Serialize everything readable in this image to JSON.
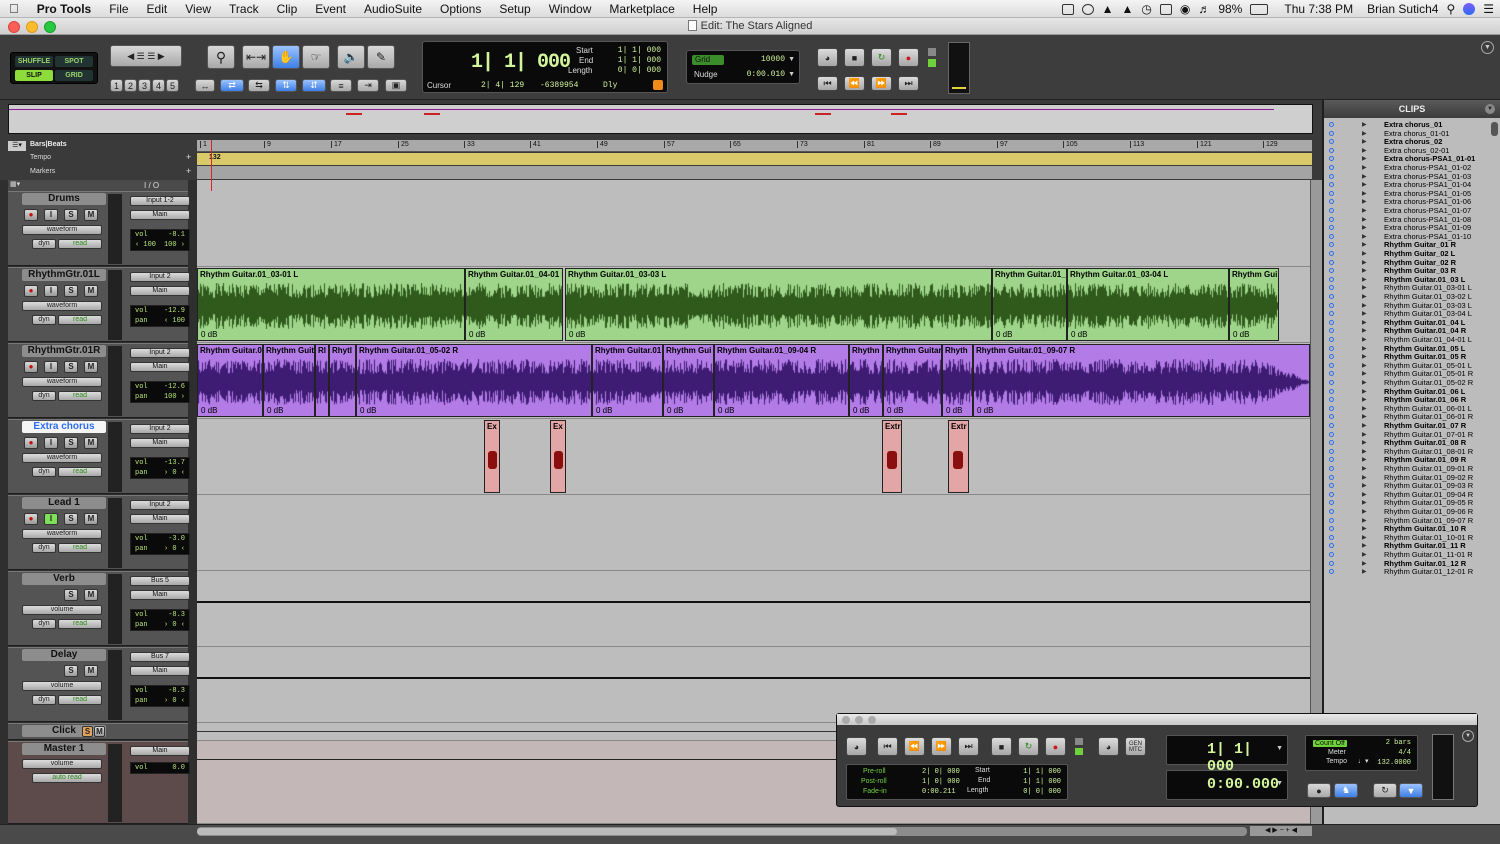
{
  "menubar": {
    "apple": "",
    "items": [
      "Pro Tools",
      "File",
      "Edit",
      "View",
      "Track",
      "Clip",
      "Event",
      "AudioSuite",
      "Options",
      "Setup",
      "Window",
      "Marketplace",
      "Help"
    ],
    "battery": "98%",
    "clock": "Thu 7:38 PM",
    "user": "Brian Sutich4"
  },
  "window": {
    "title": "Edit: The Stars Aligned"
  },
  "modes": {
    "shuffle": "SHUFFLE",
    "spot": "SPOT",
    "slip": "SLIP",
    "grid": "GRID"
  },
  "zoom_presets": [
    "1",
    "2",
    "3",
    "4",
    "5"
  ],
  "counter": {
    "main": "1| 1| 000",
    "start_label": "Start",
    "end_label": "End",
    "length_label": "Length",
    "start": "1| 1| 000",
    "end": "1| 1| 000",
    "length": "0| 0| 000",
    "cursor_label": "Cursor",
    "cursor": "2| 4| 129",
    "cursor_val": "-6389954",
    "dly": "Dly"
  },
  "grid": {
    "grid_label": "Grid",
    "grid_value": "10000",
    "nudge_label": "Nudge",
    "nudge_value": "0:00.010"
  },
  "rulers": {
    "bars_label": "Bars|Beats",
    "tempo_label": "Tempo",
    "markers_label": "Markers",
    "tempo_value": "132",
    "ticks": [
      "1",
      "9",
      "17",
      "25",
      "33",
      "41",
      "49",
      "57",
      "65",
      "73",
      "81",
      "89",
      "97",
      "105",
      "113",
      "121",
      "129"
    ]
  },
  "io_label": "I / O",
  "tracks": [
    {
      "name": "Drums",
      "io_in": "Input 1-2",
      "io_out": "Main",
      "view": "waveform",
      "dyn": "dyn",
      "auto": "read",
      "vol_label": "vol",
      "vol": "-8.1",
      "pan_label": "‹ 100",
      "pan": "100 ›",
      "selected": false
    },
    {
      "name": "RhythmGtr.01L",
      "io_in": "Input 2",
      "io_out": "Main",
      "view": "waveform",
      "dyn": "dyn",
      "auto": "read",
      "vol_label": "vol",
      "vol": "-12.9",
      "pan_label": "pan",
      "pan": "‹ 100",
      "selected": false
    },
    {
      "name": "RhythmGtr.01R",
      "io_in": "Input 2",
      "io_out": "Main",
      "view": "waveform",
      "dyn": "dyn",
      "auto": "read",
      "vol_label": "vol",
      "vol": "-12.6",
      "pan_label": "pan",
      "pan": "100 ›",
      "selected": false
    },
    {
      "name": "Extra chorus",
      "io_in": "Input 2",
      "io_out": "Main",
      "view": "waveform",
      "dyn": "dyn",
      "auto": "read",
      "vol_label": "vol",
      "vol": "-13.7",
      "pan_label": "pan",
      "pan": "› 0 ‹",
      "selected": true
    },
    {
      "name": "Lead 1",
      "io_in": "Input 2",
      "io_out": "Main",
      "view": "waveform",
      "dyn": "dyn",
      "auto": "read",
      "vol_label": "vol",
      "vol": "-3.0",
      "pan_label": "pan",
      "pan": "› 0 ‹",
      "selected": false
    },
    {
      "name": "Verb",
      "io_in": "Bus 5",
      "io_out": "Main",
      "view": "volume",
      "dyn": "dyn",
      "auto": "read",
      "vol_label": "vol",
      "vol": "-8.3",
      "pan_label": "pan",
      "pan": "› 0 ‹",
      "selected": false
    },
    {
      "name": "Delay",
      "io_in": "Bus 7",
      "io_out": "Main",
      "view": "volume",
      "dyn": "dyn",
      "auto": "read",
      "vol_label": "vol",
      "vol": "-8.3",
      "pan_label": "pan",
      "pan": "› 0 ‹",
      "selected": false
    }
  ],
  "click_track": {
    "name": "Click"
  },
  "master_track": {
    "name": "Master 1",
    "io_out": "Main",
    "view": "volume",
    "auto": "auto read",
    "vol_label": "vol",
    "vol": "0.0"
  },
  "clip_gain": "0 dB",
  "lane_clips": {
    "gtr_l": [
      "Rhythm Guitar.01_03-01 L",
      "Rhythm Guitar.01_04-01 L",
      "Rhythm Guitar.01_03-03 L",
      "Rhythm Guitar.01_",
      "Rhythm Guitar.01_03-04 L",
      "Rhythm Gui"
    ],
    "gtr_r": [
      "Rhythm Guitar.0",
      "Rhythm Guit",
      "Rl",
      "Rhytl",
      "Rhythm Guitar.01_05-02 R",
      "Rhythm Guitar.01",
      "Rhythm Gui",
      "Rhythm Guitar.01_09-04 R",
      "Rhythn",
      "Rhythm Guitar",
      "Rhyth",
      "Rhythm Guitar.01_09-07 R"
    ],
    "extra": [
      "Ex",
      "Ex",
      "Extr",
      "Extr"
    ]
  },
  "clips_list": {
    "title": "CLIPS",
    "items": [
      [
        "Extra chorus_01",
        true
      ],
      [
        "Extra chorus_01-01",
        false
      ],
      [
        "Extra chorus_02",
        true
      ],
      [
        "Extra chorus_02-01",
        false
      ],
      [
        "Extra chorus-PSA1_01-01",
        true
      ],
      [
        "Extra chorus-PSA1_01-02",
        false
      ],
      [
        "Extra chorus-PSA1_01-03",
        false
      ],
      [
        "Extra chorus-PSA1_01-04",
        false
      ],
      [
        "Extra chorus-PSA1_01-05",
        false
      ],
      [
        "Extra chorus-PSA1_01-06",
        false
      ],
      [
        "Extra chorus-PSA1_01-07",
        false
      ],
      [
        "Extra chorus-PSA1_01-08",
        false
      ],
      [
        "Extra chorus-PSA1_01-09",
        false
      ],
      [
        "Extra chorus-PSA1_01-10",
        false
      ],
      [
        "Rhythm Guitar_01 R",
        true
      ],
      [
        "Rhythm Guitar_02 L",
        true
      ],
      [
        "Rhythm Guitar_02 R",
        true
      ],
      [
        "Rhythm Guitar_03 R",
        true
      ],
      [
        "Rhythm Guitar.01_03 L",
        true
      ],
      [
        "Rhythm Guitar.01_03-01 L",
        false
      ],
      [
        "Rhythm Guitar.01_03-02 L",
        false
      ],
      [
        "Rhythm Guitar.01_03-03 L",
        false
      ],
      [
        "Rhythm Guitar.01_03-04 L",
        false
      ],
      [
        "Rhythm Guitar.01_04 L",
        true
      ],
      [
        "Rhythm Guitar.01_04 R",
        true
      ],
      [
        "Rhythm Guitar.01_04-01 L",
        false
      ],
      [
        "Rhythm Guitar.01_05 L",
        true
      ],
      [
        "Rhythm Guitar.01_05 R",
        true
      ],
      [
        "Rhythm Guitar.01_05-01 L",
        false
      ],
      [
        "Rhythm Guitar.01_05-01 R",
        false
      ],
      [
        "Rhythm Guitar.01_05-02 R",
        false
      ],
      [
        "Rhythm Guitar.01_06 L",
        true
      ],
      [
        "Rhythm Guitar.01_06 R",
        true
      ],
      [
        "Rhythm Guitar.01_06-01 L",
        false
      ],
      [
        "Rhythm Guitar.01_06-01 R",
        false
      ],
      [
        "Rhythm Guitar.01_07 R",
        true
      ],
      [
        "Rhythm Guitar.01_07-01 R",
        false
      ],
      [
        "Rhythm Guitar.01_08 R",
        true
      ],
      [
        "Rhythm Guitar.01_08-01 R",
        false
      ],
      [
        "Rhythm Guitar.01_09 R",
        true
      ],
      [
        "Rhythm Guitar.01_09-01 R",
        false
      ],
      [
        "Rhythm Guitar.01_09-02 R",
        false
      ],
      [
        "Rhythm Guitar.01_09-03 R",
        false
      ],
      [
        "Rhythm Guitar.01_09-04 R",
        false
      ],
      [
        "Rhythm Guitar.01_09-05 R",
        false
      ],
      [
        "Rhythm Guitar.01_09-06 R",
        false
      ],
      [
        "Rhythm Guitar.01_09-07 R",
        false
      ],
      [
        "Rhythm Guitar.01_10 R",
        true
      ],
      [
        "Rhythm Guitar.01_10-01 R",
        false
      ],
      [
        "Rhythm Guitar.01_11 R",
        true
      ],
      [
        "Rhythm Guitar.01_11-01 R",
        false
      ],
      [
        "Rhythm Guitar.01_12 R",
        true
      ],
      [
        "Rhythm Guitar.01_12-01 R",
        false
      ]
    ]
  },
  "transport": {
    "gen": "GEN",
    "mtc": "MTC",
    "main_counter": "1| 1| 000",
    "sub_counter": "0:00.000",
    "preroll_label": "Pre-roll",
    "postroll_label": "Post-roll",
    "fadein_label": "Fade-in",
    "preroll": "2| 0| 000",
    "postroll": "1| 0| 000",
    "fadein": "0:00.211",
    "start_label": "Start",
    "end_label": "End",
    "length_label": "Length",
    "start": "1| 1| 000",
    "end": "1| 1| 000",
    "length": "0| 0| 000",
    "countoff": "Count Off",
    "countoff_val": "2 bars",
    "meter_label": "Meter",
    "meter": "4/4",
    "tempo_label": "Tempo",
    "tempo": "132.0000"
  },
  "colors": {
    "green_clip": "#9fd58a",
    "green_wave": "#2f5a1c",
    "purple_clip": "#b27be6",
    "purple_wave": "#3e1c73",
    "red_clip": "#e3a6a6",
    "red_wave": "#8a1010",
    "accent": "#2d6cf0"
  }
}
